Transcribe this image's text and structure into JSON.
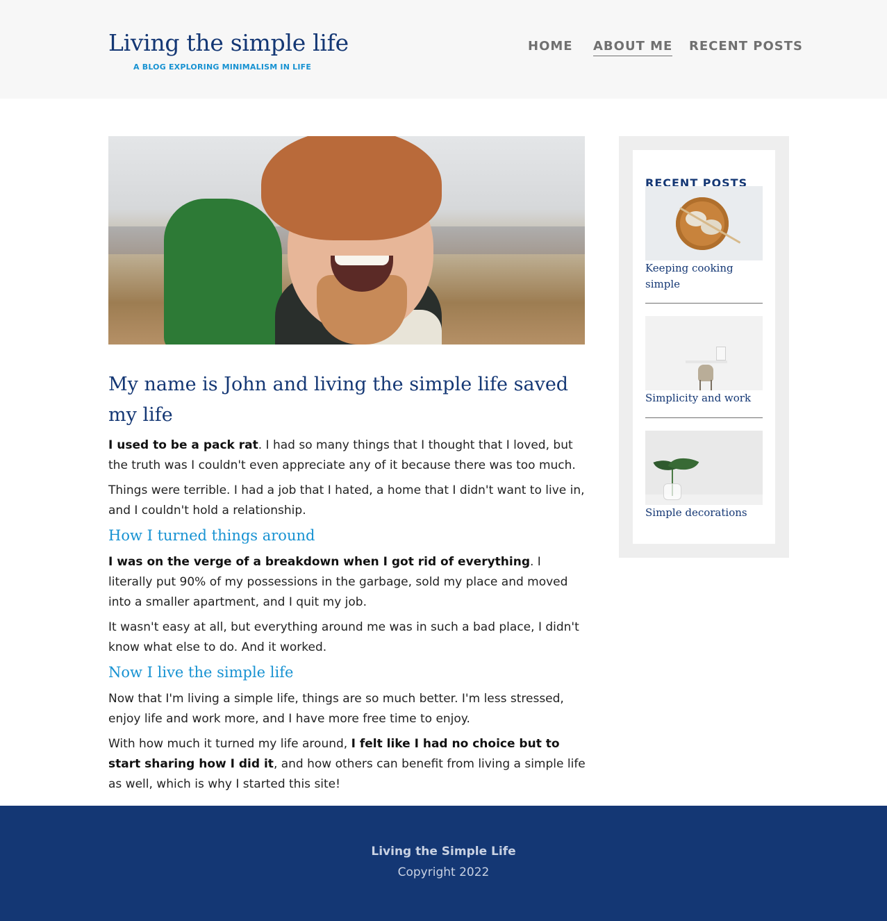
{
  "header": {
    "title": "Living the simple life",
    "subtitle": "A BLOG EXPLORING MINIMALISM IN LIFE",
    "nav": {
      "home": "HOME",
      "about": "ABOUT ME",
      "recent": "RECENT POSTS"
    }
  },
  "article": {
    "heading": "My name is John and living the simple life saved my life",
    "p1_bold": "I used to be a pack rat",
    "p1_rest": ". I had so many things that I thought that I loved, but the truth was I couldn't even appreciate any of it because there was too much.",
    "p2": "Things were terrible. I had a job that I hated, a home that I didn't want to live in, and I couldn't hold a relationship.",
    "h2_1": "How I turned things around",
    "p3_bold": "I was on the verge of a breakdown when I got rid of everything",
    "p3_rest": ". I literally put 90% of my possessions in the garbage, sold my place and moved into a smaller apartment, and I quit my job.",
    "p4": "It wasn't easy at all, but everything around me was in such a bad place, I didn't know what else to do. And it worked.",
    "h2_2": "Now I live the simple life",
    "p5": "Now that I'm living a simple life, things are so much better. I'm less stressed, enjoy life and work more, and I have more free time to enjoy.",
    "p6_start": "With how much it turned my life around, ",
    "p6_bold": "I felt like I had no choice but to start sharing how I did it",
    "p6_rest": ", and how others can benefit from living a simple life as well, which is why I started this site!"
  },
  "sidebar": {
    "title": "RECENT POSTS",
    "posts": [
      {
        "title": "Keeping cooking simple",
        "icon": "dumplings-plate-image"
      },
      {
        "title": "Simplicity and work",
        "icon": "desk-chair-image"
      },
      {
        "title": "Simple decorations",
        "icon": "plant-vase-image"
      }
    ]
  },
  "footer": {
    "name": "Living the Simple Life",
    "copyright": "Copyright 2022"
  },
  "colors": {
    "brand_dark": "#143774",
    "accent_blue": "#1792d2",
    "nav_gray": "#707070",
    "header_bg": "#f7f7f7",
    "sidebar_bg": "#eeeeee"
  }
}
